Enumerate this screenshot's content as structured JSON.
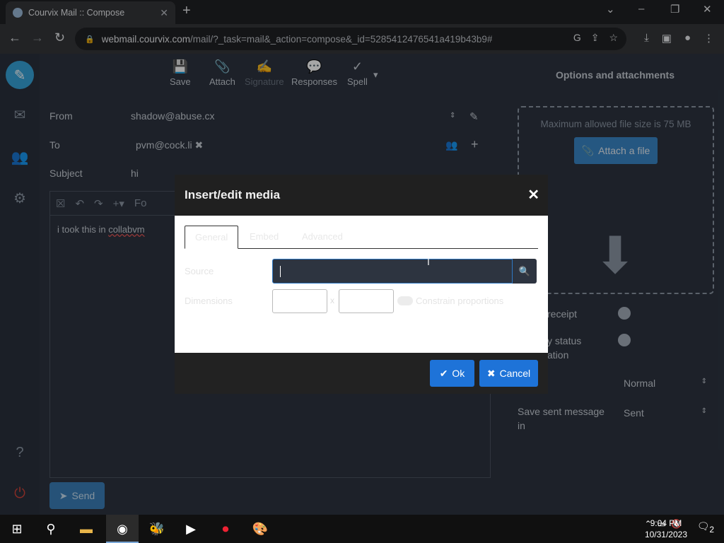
{
  "browser": {
    "tab_title": "Courvix Mail :: Compose",
    "url_host": "webmail.courvix.com",
    "url_path": "/mail/?_task=mail&_action=compose&_id=5285412476541a419b43b9#"
  },
  "toolbar": {
    "save": "Save",
    "attach": "Attach",
    "signature": "Signature",
    "responses": "Responses",
    "spell": "Spell"
  },
  "compose": {
    "from_label": "From",
    "from_value": "shadow@abuse.cx",
    "to_label": "To",
    "to_value": "pvm@cock.li",
    "subject_label": "Subject",
    "subject_value": "hi",
    "font_label": "Fo",
    "body_text_start": "i took this in ",
    "body_text_misspelled": "collabvm",
    "send": "Send"
  },
  "right_pane": {
    "title": "Options and attachments",
    "max_size": "Maximum allowed file size is 75 MB",
    "attach_button": "Attach a file",
    "return_receipt": "receipt",
    "dsn_line1": "y status",
    "dsn_line2": "ation",
    "priority_value": "Normal",
    "save_sent_label_1": "Save sent message",
    "save_sent_label_2": "in",
    "save_sent_value": "Sent"
  },
  "dialog": {
    "title": "Insert/edit media",
    "tabs": [
      "General",
      "Embed",
      "Advanced"
    ],
    "source_label": "Source",
    "dimensions_label": "Dimensions",
    "times": "x",
    "constrain": "Constrain proportions",
    "ok": "Ok",
    "cancel": "Cancel"
  },
  "taskbar": {
    "time": "9:04 PM",
    "date": "10/31/2023",
    "notifications": "2"
  }
}
